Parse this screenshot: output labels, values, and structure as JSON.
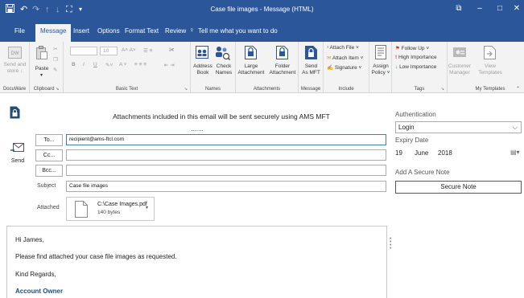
{
  "titlebar": {
    "title": "Case file images  -  Message (HTML)",
    "quick_access": [
      "save-icon",
      "undo-icon",
      "redo-icon",
      "up-icon",
      "down-icon",
      "customize-icon"
    ],
    "controls": {
      "restore": "⧉",
      "minimize": "–",
      "maximize": "□",
      "close": "✕"
    }
  },
  "tabs": [
    {
      "label": "File"
    },
    {
      "label": "Message"
    },
    {
      "label": "Insert"
    },
    {
      "label": "Options"
    },
    {
      "label": "Format Text"
    },
    {
      "label": "Review"
    },
    {
      "label": "Tell me what you want to do"
    }
  ],
  "ribbon": {
    "send_and_store_line1": "Send and",
    "send_and_store_line2": "store ↓",
    "docuware": "DocuWare",
    "paste": "Paste",
    "clipboard": "Clipboard",
    "font_size": "10",
    "basic_text": "Basic Text",
    "address_book_line1": "Address",
    "address_book_line2": "Book",
    "check_names_line1": "Check",
    "check_names_line2": "Names",
    "names": "Names",
    "large_attachment_line1": "Large",
    "large_attachment_line2": "Attachment",
    "folder_attachment_line1": "Folder",
    "folder_attachment_line2": "Attachment",
    "attachments": "Attachments",
    "send_as_mft_line1": "Send",
    "send_as_mft_line2": "As MFT",
    "message": "Message",
    "attach_file": "Attach File ˅",
    "attach_item": "Attach Item ˅",
    "signature": "Signature ˅",
    "include": "Include",
    "assign_policy_line1": "Assign",
    "assign_policy_line2": "Policy ˅",
    "follow_up": "Follow Up ˅",
    "high_importance": "High Importance",
    "low_importance": "Low Importance",
    "tags": "Tags",
    "customer_manager_line1": "Customer",
    "customer_manager_line2": "Manager",
    "view_templates_line1": "View",
    "view_templates_line2": "Templates",
    "my_templates": "My Templates"
  },
  "banner": "Attachments included in this email will be sent securely using AMS MFT",
  "banner_dots": ".......",
  "compose": {
    "send_label": "Send",
    "to_button": "To...",
    "to_value": "recipient@ams-ftcl.com",
    "cc_button": "Cc...",
    "cc_value": "",
    "bcc_button": "Bcc...",
    "bcc_value": "",
    "subject_label": "Subject",
    "subject_value": "Case file images",
    "attached_label": "Attached",
    "attachment_name": "C:\\Case Images.pdf",
    "attachment_size": "140 bytes"
  },
  "body_lines": [
    "Hi James,",
    "Please find attached your case file images as requested.",
    "Kind Regards,",
    "Account Owner"
  ],
  "right_pane": {
    "authentication_label": "Authentication",
    "authentication_value": "Login",
    "expiry_label": "Expiry Date",
    "expiry_day": "19",
    "expiry_month": "June",
    "expiry_year": "2018",
    "secure_note_label": "Add A Secure Note",
    "secure_note_button": "Secure Note"
  },
  "colors": {
    "accent": "#2b579a",
    "ribbon_bg": "#f3f3f3",
    "follow_up_flag": "#c0392b",
    "high_importance": "#c0392b",
    "low_importance": "#1e6ad1"
  }
}
